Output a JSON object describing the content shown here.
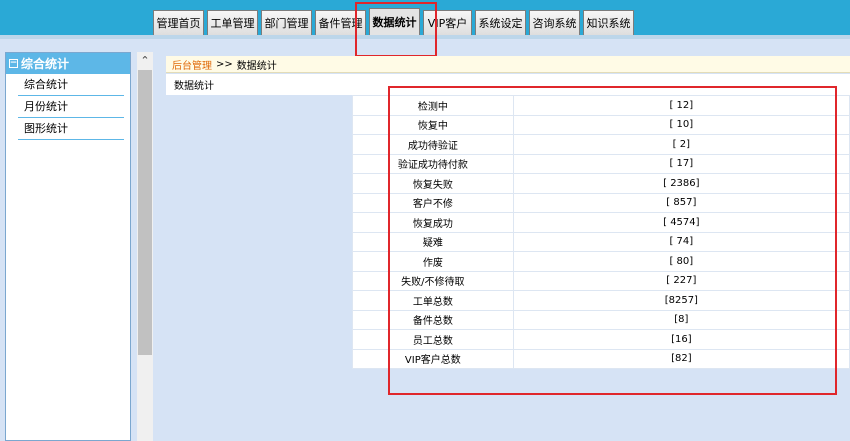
{
  "nav": {
    "tabs": [
      {
        "label": "管理首页"
      },
      {
        "label": "工单管理"
      },
      {
        "label": "部门管理"
      },
      {
        "label": "备件管理"
      },
      {
        "label": "数据统计"
      },
      {
        "label": "VIP客户"
      },
      {
        "label": "系统设定"
      },
      {
        "label": "咨询系统"
      },
      {
        "label": "知识系统"
      }
    ],
    "active_tab": "数据统计"
  },
  "sidebar": {
    "header": "综合统计",
    "items": [
      {
        "label": "综合统计"
      },
      {
        "label": "月份统计"
      },
      {
        "label": "图形统计"
      }
    ]
  },
  "breadcrumb": {
    "home": "后台管理",
    "separator": ">>",
    "current": "数据统计"
  },
  "main": {
    "subtitle": "数据统计"
  },
  "stats": [
    {
      "label": "检测中",
      "value": "[ 12]"
    },
    {
      "label": "恢复中",
      "value": "[ 10]"
    },
    {
      "label": "成功待验证",
      "value": "[ 2]"
    },
    {
      "label": "验证成功待付款",
      "value": "[ 17]"
    },
    {
      "label": "恢复失败",
      "value": "[ 2386]"
    },
    {
      "label": "客户不修",
      "value": "[ 857]"
    },
    {
      "label": "恢复成功",
      "value": "[ 4574]"
    },
    {
      "label": "疑难",
      "value": "[ 74]"
    },
    {
      "label": "作废",
      "value": "[ 80]"
    },
    {
      "label": "失败/不修待取",
      "value": "[ 227]"
    },
    {
      "label": "工单总数",
      "value": "[8257]"
    },
    {
      "label": "备件总数",
      "value": "[8]"
    },
    {
      "label": "员工总数",
      "value": "[16]"
    },
    {
      "label": "VIP客户总数",
      "value": "[82]"
    }
  ],
  "colors": {
    "nav_bar": "#2aa9d6",
    "sidebar_header": "#5db7e7",
    "page_bg": "#d6e3f5",
    "breadcrumb_home": "#e06a0a",
    "annotation_box": "#e0262b"
  },
  "icons": {
    "collapse": "collapse-icon",
    "scroll_up": "scroll-up-icon"
  }
}
